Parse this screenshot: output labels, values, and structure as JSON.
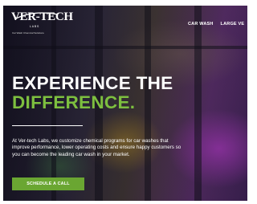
{
  "brand": {
    "name": "VER-TECH",
    "sub": "LABS",
    "tagline": "Car Wash Chemical Solutions"
  },
  "nav": {
    "items": [
      {
        "label": "CAR WASH"
      },
      {
        "label": "LARGE VE"
      }
    ]
  },
  "hero": {
    "headline_line1": "EXPERIENCE THE",
    "headline_line2": "DIFFERENCE.",
    "body": "At Ver-tech Labs, we customize chemical programs for car washes that improve performance, lower operating costs and ensure happy customers so you can become the leading car wash in your market.",
    "cta_label": "SCHEDULE A CALL"
  },
  "colors": {
    "accent_green": "#7dbf3f",
    "button_green": "#6aa632",
    "text_light": "#ffffff"
  }
}
